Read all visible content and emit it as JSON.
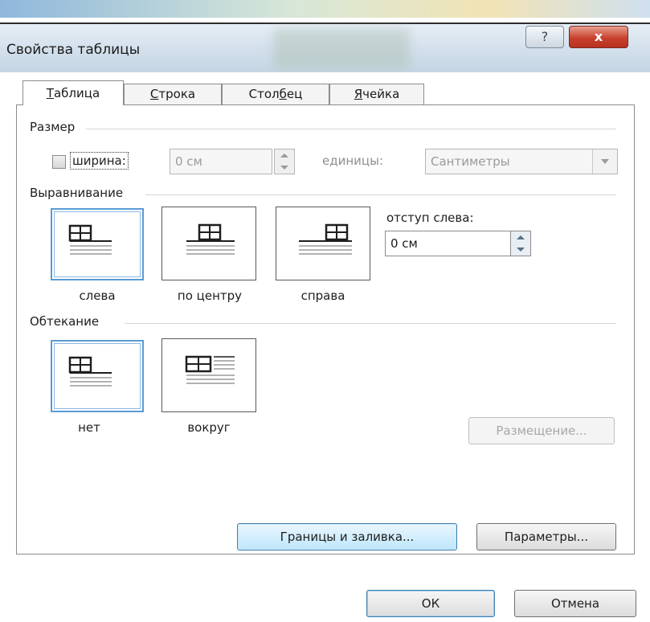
{
  "window": {
    "title": "Свойства таблицы",
    "help_glyph": "?",
    "close_glyph": "x"
  },
  "tabs": [
    {
      "prefix": "",
      "mnemonic": "Т",
      "rest": "аблица",
      "active": true
    },
    {
      "prefix": "",
      "mnemonic": "С",
      "rest": "трока",
      "active": false
    },
    {
      "prefix": "Стол",
      "mnemonic": "б",
      "rest": "ец",
      "active": false
    },
    {
      "prefix": "",
      "mnemonic": "Я",
      "rest": "чейка",
      "active": false
    }
  ],
  "size": {
    "group_label": "Размер",
    "width_checkbox_label": "ширина:",
    "width_checked": false,
    "width_value": "0 см",
    "units_label": "единицы:",
    "units_value": "Сантиметры"
  },
  "alignment": {
    "group_label": "Выравнивание",
    "options": [
      {
        "label": "слева",
        "selected": true
      },
      {
        "label": "по центру",
        "selected": false
      },
      {
        "label": "справа",
        "selected": false
      }
    ],
    "indent_label": "отступ слева:",
    "indent_value": "0 см"
  },
  "wrapping": {
    "group_label": "Обтекание",
    "options": [
      {
        "label": "нет",
        "selected": true
      },
      {
        "label": "вокруг",
        "selected": false
      }
    ],
    "positioning_button": "Размещение..."
  },
  "buttons": {
    "borders_shading": "Границы и заливка...",
    "options": "Параметры...",
    "ok": "ОК",
    "cancel": "Отмена"
  },
  "colors": {
    "selection_border": "#5b9bd5",
    "focus_button": "#bee6fd",
    "close_button": "#c8412e"
  }
}
